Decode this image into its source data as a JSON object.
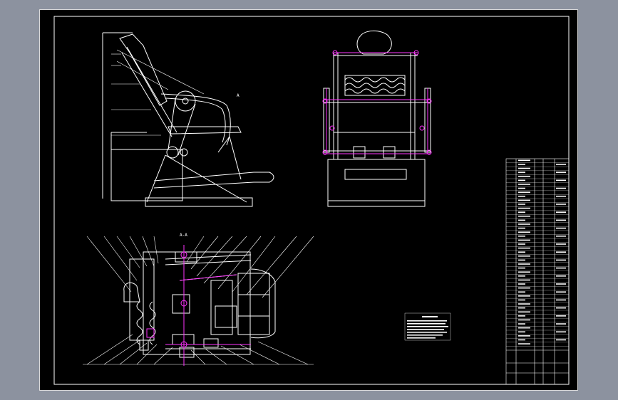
{
  "drawing": {
    "background": "#000000",
    "line_color": "#ffffff",
    "highlight_color": "#ff33ff",
    "views": [
      {
        "name": "side-view",
        "type": "elevation"
      },
      {
        "name": "front-view",
        "type": "elevation"
      },
      {
        "name": "section-view",
        "type": "section"
      }
    ]
  },
  "labels": {
    "section_mark": "A-A",
    "side_callout": "A"
  },
  "icons": [
    "sprocket-icon",
    "chain-icon",
    "wheel-icon"
  ]
}
